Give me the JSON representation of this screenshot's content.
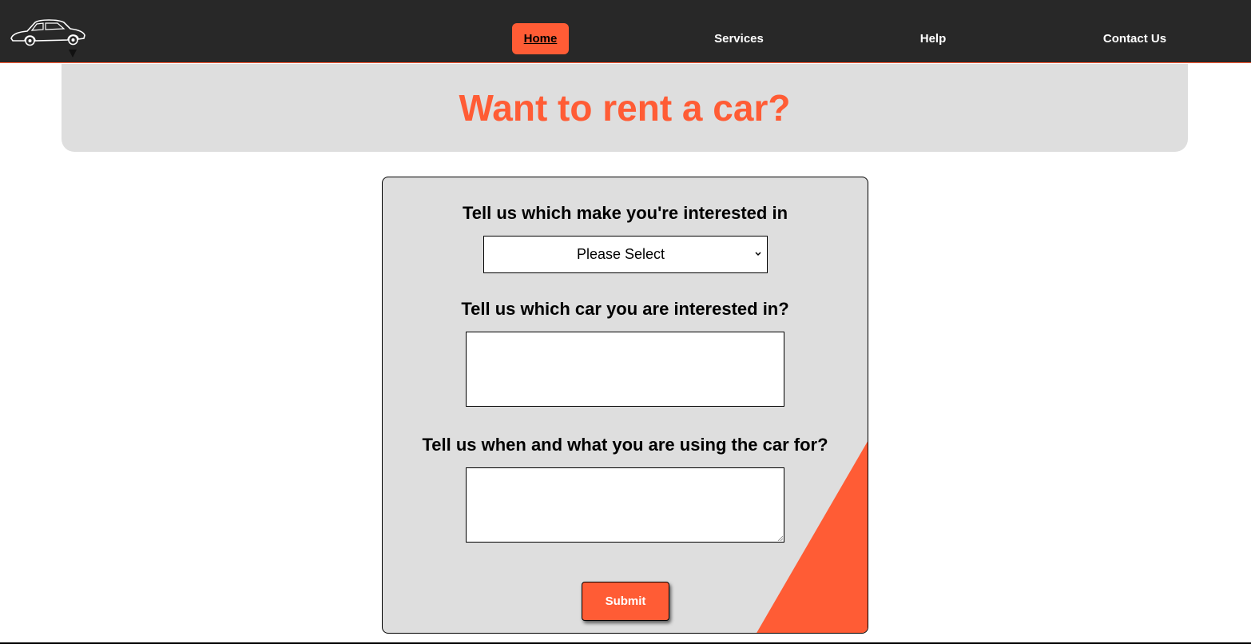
{
  "nav": {
    "logo_icon": "car-logo-icon",
    "items": [
      {
        "label": "Home",
        "active": true
      },
      {
        "label": "Services",
        "active": false
      },
      {
        "label": "Help",
        "active": false
      },
      {
        "label": "Contact Us",
        "active": false
      }
    ]
  },
  "hero": {
    "title": "Want to rent a car?"
  },
  "form": {
    "make_label": "Tell us which make you're interested in",
    "make_select": {
      "selected": "Please Select",
      "icon": "chevron-down-icon"
    },
    "car_label": "Tell us which car you are interested in?",
    "car_value": "",
    "usage_label": "Tell us when and what you are using the car for?",
    "usage_value": "",
    "submit_label": "Submit"
  },
  "colors": {
    "accent": "#ff5c35",
    "navbar": "#282828",
    "panel": "#dedede"
  }
}
